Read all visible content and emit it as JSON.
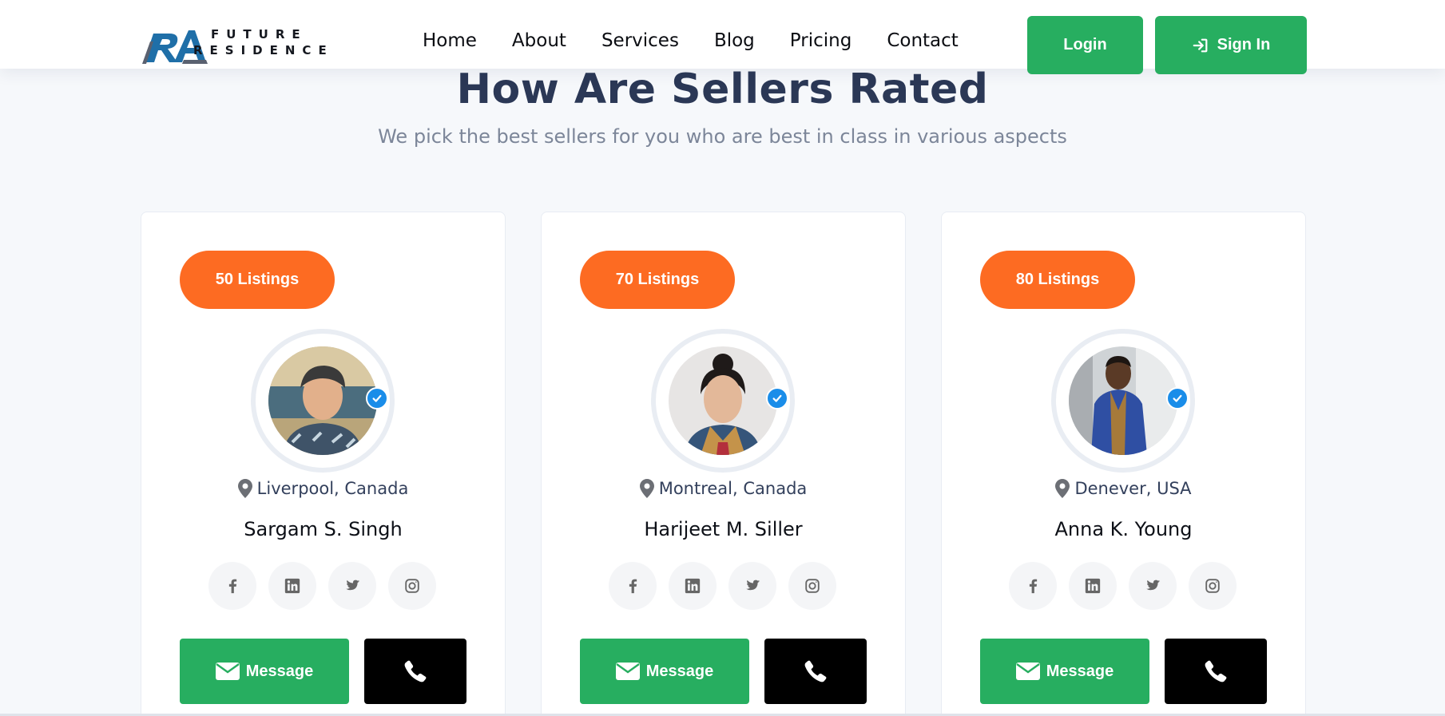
{
  "brand": {
    "logo_mark": "RA",
    "line1": "FUTURE",
    "line2": "RESIDENCE",
    "colors": {
      "blue": "#1f6fa8",
      "gray": "#5a6170",
      "dark": "#15181f"
    }
  },
  "nav": {
    "items": [
      "Home",
      "About",
      "Services",
      "Blog",
      "Pricing",
      "Contact"
    ]
  },
  "auth": {
    "login_label": "Login",
    "signin_label": "Sign In",
    "signin_icon": "sign-in-icon"
  },
  "section": {
    "title": "How Are Sellers Rated",
    "subtitle": "We pick the best sellers for you who are best in class in various aspects"
  },
  "sellers": [
    {
      "listings": "50 Listings",
      "location": "Liverpool, Canada",
      "name": "Sargam S. Singh",
      "avatar": "seller-photo",
      "verified_icon": "check-icon"
    },
    {
      "listings": "70 Listings",
      "location": "Montreal, Canada",
      "name": "Harijeet M. Siller",
      "avatar": "seller-photo",
      "verified_icon": "check-icon"
    },
    {
      "listings": "80 Listings",
      "location": "Denever, USA",
      "name": "Anna K. Young",
      "avatar": "seller-photo",
      "verified_icon": "check-icon"
    }
  ],
  "card_actions": {
    "message_label": "Message",
    "message_icon": "envelope-icon",
    "call_icon": "phone-icon",
    "socials": [
      "facebook-icon",
      "linkedin-icon",
      "twitter-icon",
      "instagram-icon"
    ]
  },
  "colors": {
    "green": "#27ae60",
    "orange": "#fd6b22",
    "verified_blue": "#1a8de9",
    "heading": "#2b3856",
    "subtext": "#7c8699",
    "page_bg": "#f6f8fb"
  }
}
